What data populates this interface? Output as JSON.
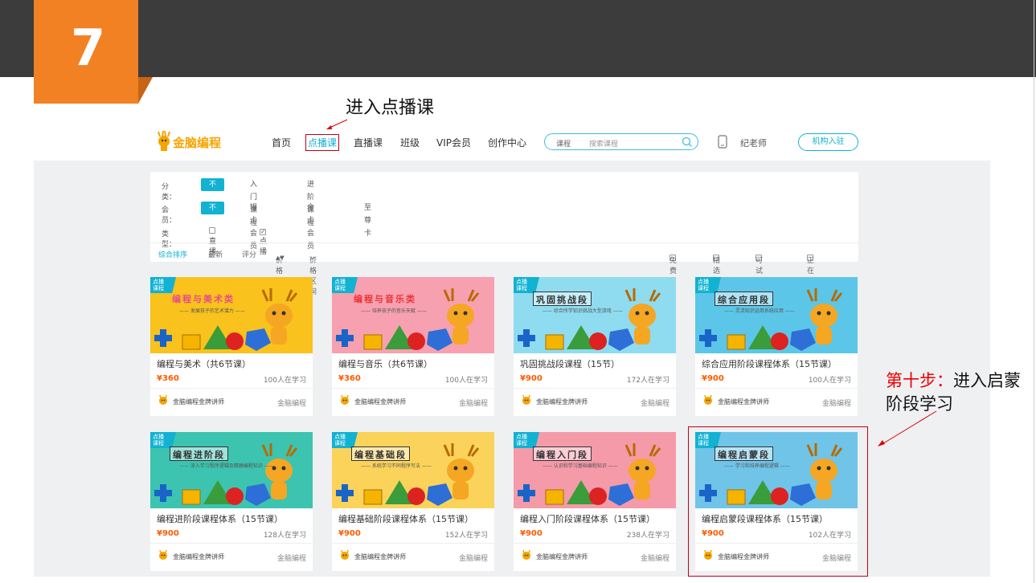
{
  "slide": {
    "step_number": "7",
    "annotation_top": "进入点播课",
    "annotation_step_prefix": "第十步：",
    "annotation_step_rest": "进入启蒙阶段学习"
  },
  "header": {
    "logo_text": "金脑编程",
    "nav": [
      "首页",
      "点播课",
      "直播课",
      "班级",
      "VIP会员",
      "创作中心"
    ],
    "active_nav": "点播课",
    "search": {
      "category": "课程",
      "placeholder": "搜索课程"
    },
    "user": "纪老师",
    "org_button": "机构入驻"
  },
  "filters": {
    "category": {
      "label": "分类：",
      "options": [
        "不限",
        "入门课程",
        "进阶课程"
      ],
      "selected": "不限"
    },
    "member": {
      "label": "会员：",
      "options": [
        "不限",
        "银卡会员",
        "金卡会员",
        "至尊卡"
      ],
      "selected": "不限"
    },
    "type": {
      "label": "类型：",
      "options": [
        {
          "label": "直播",
          "checked": false
        },
        {
          "label": "点播",
          "checked": true
        }
      ]
    }
  },
  "sort": {
    "items": [
      "综合排序",
      "最新",
      "评分",
      "价格",
      "价格区间"
    ],
    "active": "综合排序",
    "checks": [
      "免费",
      "精选",
      "可试听",
      "正在直播"
    ]
  },
  "courses": [
    {
      "tag": "点播课程",
      "banner": "编程与美术类",
      "banner_sub": "—— 发展孩子的艺术潜力 ——",
      "title": "编程与美术（共6节课）",
      "price": "¥360",
      "learners": "100人在学习",
      "teacher": "金脑编程金牌讲师",
      "org": "金脑编程",
      "bg": "#f9c21c",
      "banner_color": "#e94b8a"
    },
    {
      "tag": "点播课程",
      "banner": "编程与音乐类",
      "banner_sub": "—— 培养孩子的音乐天赋 ——",
      "title": "编程与音乐（共6节课）",
      "price": "¥360",
      "learners": "100人在学习",
      "teacher": "金脑编程金牌讲师",
      "org": "金脑编程",
      "bg": "#f7a0b0",
      "banner_color": "#e33"
    },
    {
      "tag": "点播课程",
      "banner": "巩固挑战段",
      "banner_sub": "—— 综合所学知识挑战大型游戏 ——",
      "title": "巩固挑战段课程（15节）",
      "price": "¥900",
      "learners": "172人在学习",
      "teacher": "金脑编程金牌讲师",
      "org": "金脑编程",
      "bg": "#8fdcf0",
      "banner_color": "#333"
    },
    {
      "tag": "点播课程",
      "banner": "综合应用段",
      "banner_sub": "—— 灵活知识运用系统应用 ——",
      "title": "综合应用阶段课程体系（15节课）",
      "price": "¥900",
      "learners": "100人在学习",
      "teacher": "金脑编程金牌讲师",
      "org": "金脑编程",
      "bg": "#5cc6e8",
      "banner_color": "#333"
    },
    {
      "tag": "点播课程",
      "banner": "编程进阶段",
      "banner_sub": "—— 深入学习程序逻辑及精确编程知识 ——",
      "title": "编程进阶段课程体系（15节课）",
      "price": "¥900",
      "learners": "128人在学习",
      "teacher": "金脑编程金牌讲师",
      "org": "金脑编程",
      "bg": "#3cc4b0",
      "banner_color": "#333"
    },
    {
      "tag": "点播课程",
      "banner": "编程基础段",
      "banner_sub": "—— 系统学习不同程序写法 ——",
      "title": "编程基础阶段课程体系（15节课）",
      "price": "¥900",
      "learners": "152人在学习",
      "teacher": "金脑编程金牌讲师",
      "org": "金脑编程",
      "bg": "#fbd35a",
      "banner_color": "#333"
    },
    {
      "tag": "点播课程",
      "banner": "编程入门段",
      "banner_sub": "—— 认识和学习基础编程知识 ——",
      "title": "编程入门阶段课程体系（15节课）",
      "price": "¥900",
      "learners": "238人在学习",
      "teacher": "金脑编程金牌讲师",
      "org": "金脑编程",
      "bg": "#f59aa8",
      "banner_color": "#333"
    },
    {
      "tag": "点播课程",
      "banner": "编程启蒙段",
      "banner_sub": "—— 学习和培养编程逻辑 ——",
      "title": "编程启蒙段课程体系（15节课）",
      "price": "¥900",
      "learners": "102人在学习",
      "teacher": "金脑编程金牌讲师",
      "org": "金脑编程",
      "bg": "#6fc4e8",
      "banner_color": "#333"
    }
  ],
  "colors": {
    "accent": "#11b2d2",
    "price": "#ff5a00",
    "badge": "#f28124",
    "annotation_red": "#e00"
  },
  "icons": [
    "search-icon",
    "phone-icon",
    "deer-mascot-icon",
    "arrow-icon",
    "checkbox-icon",
    "sort-arrows-icon",
    "chevron-down-icon"
  ]
}
